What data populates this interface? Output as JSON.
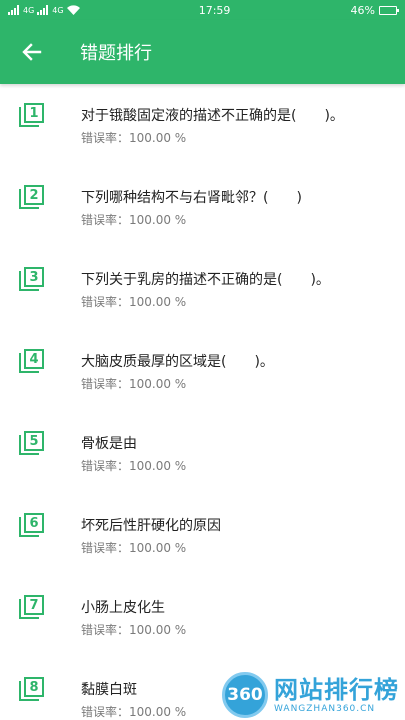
{
  "status_bar": {
    "carrier_signal_1": "4G",
    "carrier_signal_2": "4G",
    "time": "17:59",
    "battery": "46%",
    "battery_level": 0.46
  },
  "toolbar": {
    "back_icon": "arrow-left-icon",
    "title": "错题排行"
  },
  "items": [
    {
      "rank": "1",
      "title": "对于锇酸固定液的描述不正确的是(　　)。",
      "rate": "错误率：100.00 %"
    },
    {
      "rank": "2",
      "title": "下列哪种结构不与右肾毗邻？(　　)",
      "rate": "错误率：100.00 %"
    },
    {
      "rank": "3",
      "title": "下列关于乳房的描述不正确的是(　　)。",
      "rate": "错误率：100.00 %"
    },
    {
      "rank": "4",
      "title": "大脑皮质最厚的区域是(　　)。",
      "rate": "错误率：100.00 %"
    },
    {
      "rank": "5",
      "title": "骨板是由",
      "rate": "错误率：100.00 %"
    },
    {
      "rank": "6",
      "title": "坏死后性肝硬化的原因",
      "rate": "错误率：100.00 %"
    },
    {
      "rank": "7",
      "title": "小肠上皮化生",
      "rate": "错误率：100.00 %"
    },
    {
      "rank": "8",
      "title": "黏膜白斑",
      "rate": "错误率：100.00 %"
    }
  ],
  "watermark": {
    "logo": "360",
    "name": "网站排行榜",
    "url": "WANGZHAN360.CN"
  },
  "colors": {
    "accent": "#2eb56a",
    "watermark": "#2a9fd8"
  }
}
